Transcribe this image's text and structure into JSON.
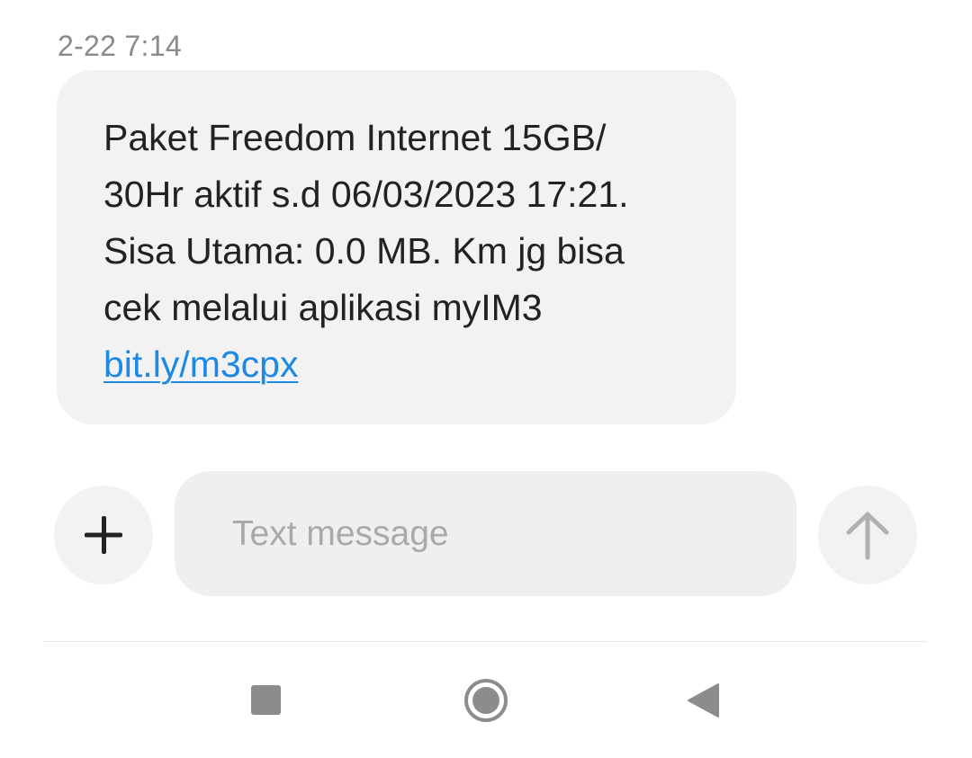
{
  "message": {
    "timestamp": "2-22 7:14",
    "lines": [
      "Paket Freedom Internet 15GB/",
      "30Hr aktif s.d 06/03/2023 17:21.",
      "Sisa Utama: 0.0 MB. Km jg bisa",
      "cek melalui aplikasi myIM3"
    ],
    "link": "bit.ly/m3cpx"
  },
  "composer": {
    "placeholder": "Text message",
    "add_icon": "plus-icon",
    "send_icon": "arrow-up-icon"
  },
  "navbar": {
    "recent_icon": "square-icon",
    "home_icon": "circle-icon",
    "back_icon": "triangle-back-icon"
  },
  "colors": {
    "bubble": "#f2f2f2",
    "link": "#1e88e5",
    "text": "#222222",
    "placeholder": "#a9a9a9"
  }
}
